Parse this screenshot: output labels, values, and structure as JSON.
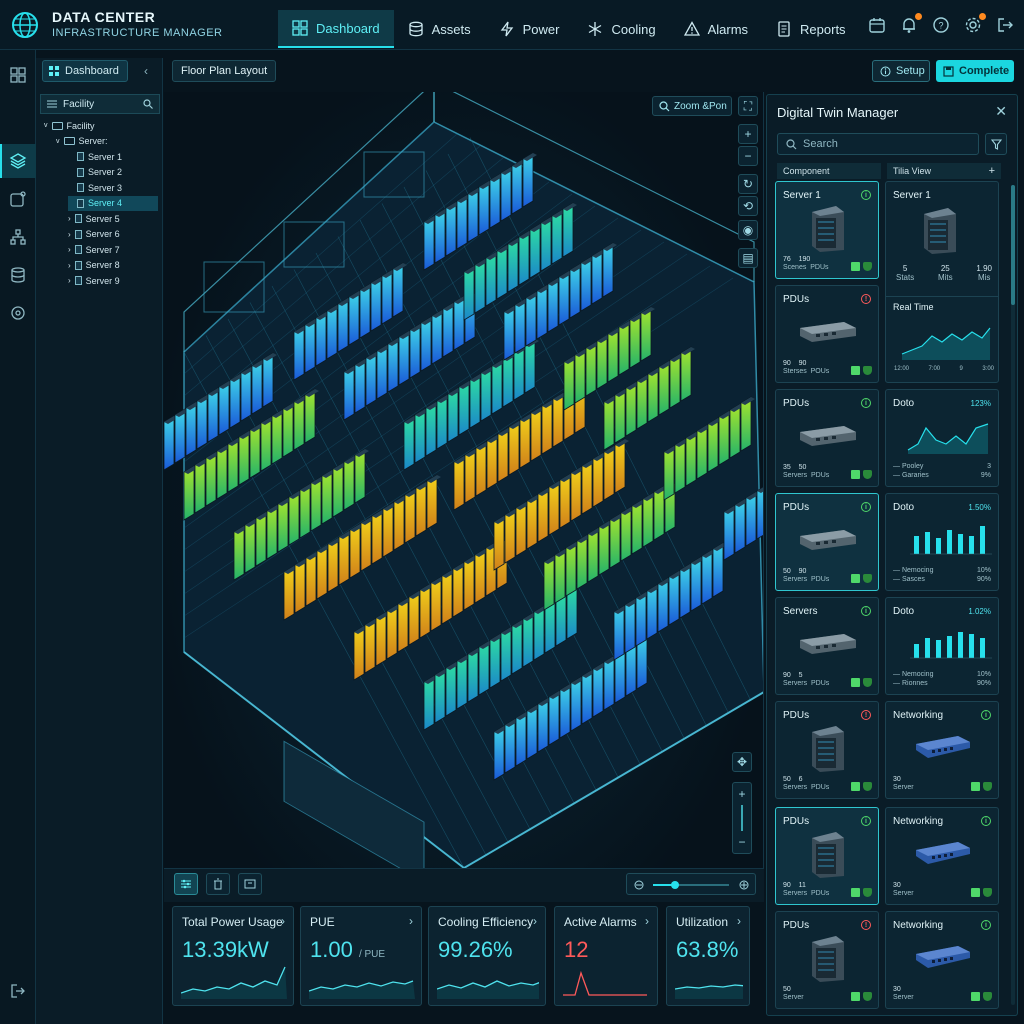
{
  "brand": {
    "title": "DATA CENTER",
    "subtitle": "INFRASTRUCTURE MANAGER"
  },
  "nav": [
    {
      "label": "Dashboard",
      "icon": "dashboard-icon",
      "active": true
    },
    {
      "label": "Assets",
      "icon": "assets-icon"
    },
    {
      "label": "Power",
      "icon": "power-icon"
    },
    {
      "label": "Cooling",
      "icon": "cooling-icon"
    },
    {
      "label": "Alarms",
      "icon": "alarm-icon"
    },
    {
      "label": "Reports",
      "icon": "reports-icon"
    }
  ],
  "sidebar": {
    "dashboard_label": "Dashboard",
    "facility_label": "Facility",
    "tree": [
      {
        "label": "Facility",
        "level": 0,
        "kind": "folder"
      },
      {
        "label": "Server:",
        "level": 1,
        "kind": "folder"
      },
      {
        "label": "Server 1",
        "level": 2,
        "kind": "server"
      },
      {
        "label": "Server 2",
        "level": 2,
        "kind": "server"
      },
      {
        "label": "Server 3",
        "level": 2,
        "kind": "server"
      },
      {
        "label": "Server 4",
        "level": 2,
        "kind": "server",
        "selected": true
      },
      {
        "label": "Server 5",
        "level": 2,
        "kind": "server",
        "arrow": true
      },
      {
        "label": "Server 6",
        "level": 2,
        "kind": "server",
        "arrow": true
      },
      {
        "label": "Server 7",
        "level": 2,
        "kind": "server",
        "arrow": true
      },
      {
        "label": "Server 8",
        "level": 2,
        "kind": "server",
        "arrow": true
      },
      {
        "label": "Server 9",
        "level": 2,
        "kind": "server",
        "arrow": true
      }
    ]
  },
  "toolbar": {
    "floor_plan_label": "Floor Plan Layout",
    "setup_label": "Setup",
    "complete_label": "Complete"
  },
  "viewport": {
    "zoom_pan_label": "Zoom &Pon"
  },
  "kpis": [
    {
      "title": "Total Power Usage",
      "value": "13.39kW",
      "unit": "",
      "color": "#4fe3ee"
    },
    {
      "title": "PUE",
      "value": "1.00",
      "unit": "/ PUE",
      "color": "#4fe3ee"
    },
    {
      "title": "Cooling Efficiency",
      "value": "99.26%",
      "unit": "",
      "color": "#4fe3ee"
    },
    {
      "title": "Active Alarms",
      "value": "12",
      "unit": "",
      "color": "#ff5a5a"
    },
    {
      "title": "Utilization",
      "value": "63.8%",
      "unit": "",
      "color": "#4fe3ee"
    }
  ],
  "twin": {
    "title": "Digital Twin Manager",
    "search_placeholder": "Search",
    "col_component": "Component",
    "col_view": "Tilia View",
    "components": [
      {
        "title": "Server 1",
        "status": "ok",
        "s1": "76",
        "l1": "Scenes",
        "s2": "190",
        "l2": "PDUs",
        "highlight": true
      },
      {
        "title": "PDUs",
        "status": "alert",
        "s1": "90",
        "l1": "Sterses",
        "s2": "90",
        "l2": "POUs"
      },
      {
        "title": "PDUs",
        "status": "ok",
        "s1": "35",
        "l1": "Servers",
        "s2": "50",
        "l2": "PDUs"
      },
      {
        "title": "PDUs",
        "status": "ok",
        "s1": "50",
        "l1": "Servers",
        "s2": "90",
        "l2": "PDUs",
        "highlight": true
      },
      {
        "title": "Servers",
        "status": "ok",
        "s1": "90",
        "l1": "Servers",
        "s2": "5",
        "l2": "PDUs"
      },
      {
        "title": "PDUs",
        "status": "alert",
        "s1": "50",
        "l1": "Servers",
        "s2": "6",
        "l2": "PDUs"
      },
      {
        "title": "PDUs",
        "status": "ok",
        "s1": "90",
        "l1": "Servers",
        "s2": "11",
        "l2": "PDUs",
        "highlight": true
      },
      {
        "title": "PDUs",
        "status": "alert",
        "s1": "50",
        "l1": "Server",
        "s2": "",
        "l2": ""
      }
    ],
    "views": [
      {
        "title": "Server 1",
        "kind": "detail",
        "stats": [
          "5",
          "25",
          "1.90"
        ],
        "stat_labels": [
          "Stats",
          "Mits",
          "Mis"
        ],
        "realtime": "Real Time",
        "axis": [
          "12:00",
          "7:00",
          "9",
          "3:00"
        ]
      },
      {
        "title": "Doto",
        "kind": "area",
        "value": "123%",
        "legend": [
          "Pooley",
          "Gararies"
        ],
        "legend_vals": [
          "3",
          "9%"
        ]
      },
      {
        "title": "Doto",
        "kind": "bar",
        "value": "1.50%",
        "legend": [
          "Nemocing",
          "Sasces"
        ],
        "legend_vals": [
          "10%",
          "90%"
        ]
      },
      {
        "title": "Doto",
        "kind": "bar",
        "value": "1.02%",
        "legend": [
          "Nemocing",
          "Rionnes"
        ],
        "legend_vals": [
          "10%",
          "90%"
        ]
      },
      {
        "title": "Networking",
        "kind": "device",
        "status": "ok",
        "s1": "30",
        "l1": "Server"
      },
      {
        "title": "Networking",
        "kind": "device",
        "status": "ok",
        "s1": "30",
        "l1": "Server"
      },
      {
        "title": "Networking",
        "kind": "device",
        "status": "ok",
        "s1": "30",
        "l1": "Server"
      }
    ]
  },
  "colors": {
    "accent": "#27e0ec",
    "alert": "#ff5a5a",
    "ok": "#4fd86a",
    "bg": "#07141d"
  }
}
